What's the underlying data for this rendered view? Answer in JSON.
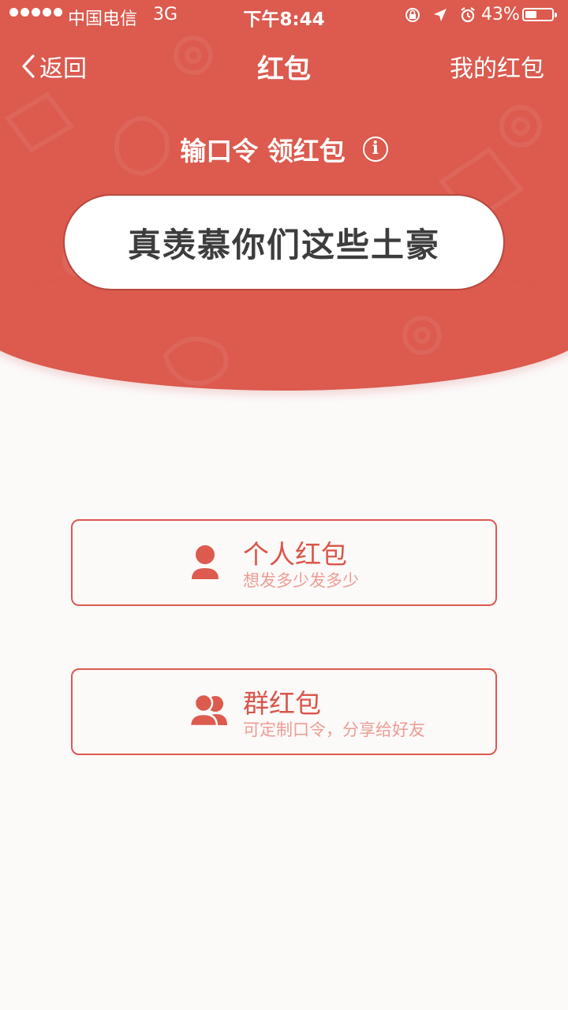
{
  "status_bar": {
    "carrier": "中国电信",
    "network": "3G",
    "time": "下午8:44",
    "battery_percent_text": "43%",
    "battery_level": 0.43
  },
  "nav": {
    "back_label": "返回",
    "title": "红包",
    "right_label": "我的红包"
  },
  "prompt": {
    "label": "输口令 领红包",
    "info_icon": "info-icon"
  },
  "password": {
    "value": "真羡慕你们这些土豪"
  },
  "options": [
    {
      "title": "个人红包",
      "subtitle": "想发多少发多少",
      "icon": "person-icon"
    },
    {
      "title": "群红包",
      "subtitle": "可定制口令，分享给好友",
      "icon": "group-icon"
    }
  ],
  "colors": {
    "brand_red": "#dc5a4e",
    "background": "#fcf9f9",
    "subtitle": "#ec9d94"
  }
}
